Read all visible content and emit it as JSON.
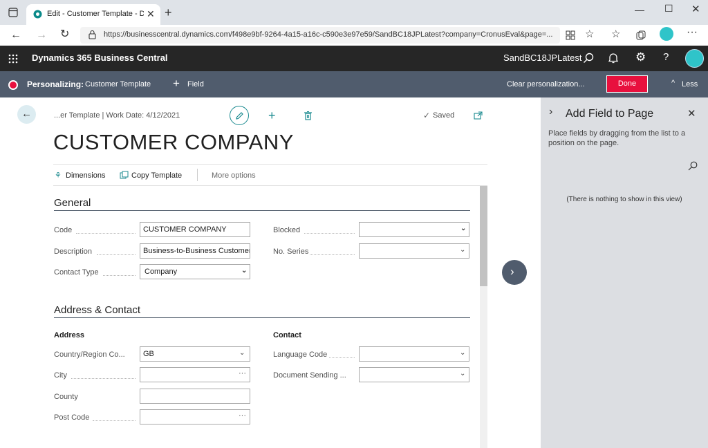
{
  "browser": {
    "tab_title": "Edit - Customer Template - Dyna",
    "url": "https://businesscentral.dynamics.com/f498e9bf-9264-4a15-a16c-c590e3e97e59/SandBC18JPLatest?company=CronusEval&page=...",
    "profile_initials": ""
  },
  "app": {
    "title": "Dynamics 365 Business Central",
    "environment": "SandBC18JPLatest"
  },
  "personalize_bar": {
    "label": "Personalizing:",
    "page": "Customer Template",
    "field_label": "Field",
    "clear_label": "Clear personalization...",
    "done_label": "Done",
    "less_label": "Less"
  },
  "page": {
    "breadcrumb": "...er Template | Work Date: 4/12/2021",
    "saved_label": "Saved",
    "title": "CUSTOMER COMPANY",
    "actions": {
      "dimensions": "Dimensions",
      "copy_template": "Copy Template",
      "more_options": "More options"
    }
  },
  "general": {
    "title": "General",
    "code_label": "Code",
    "code_value": "CUSTOMER COMPANY",
    "description_label": "Description",
    "description_value": "Business-to-Business Customer",
    "contact_type_label": "Contact Type",
    "contact_type_value": "Company",
    "blocked_label": "Blocked",
    "blocked_value": "",
    "no_series_label": "No. Series",
    "no_series_value": ""
  },
  "address_contact": {
    "title": "Address & Contact",
    "address_subtitle": "Address",
    "contact_subtitle": "Contact",
    "country_label": "Country/Region Co...",
    "country_value": "GB",
    "city_label": "City",
    "city_value": "",
    "county_label": "County",
    "county_value": "",
    "post_code_label": "Post Code",
    "post_code_value": "",
    "language_label": "Language Code",
    "language_value": "",
    "doc_sending_label": "Document Sending ...",
    "doc_sending_value": ""
  },
  "side_panel": {
    "title": "Add Field to Page",
    "description": "Place fields by dragging from the list to a position on the page.",
    "empty_text": "(There is nothing to show in this view)"
  },
  "icons": {
    "back": "back-arrow-icon",
    "edit": "pencil-icon",
    "new": "plus-icon",
    "delete": "trash-icon",
    "popout": "popout-icon",
    "next": "chevron-right-icon"
  }
}
